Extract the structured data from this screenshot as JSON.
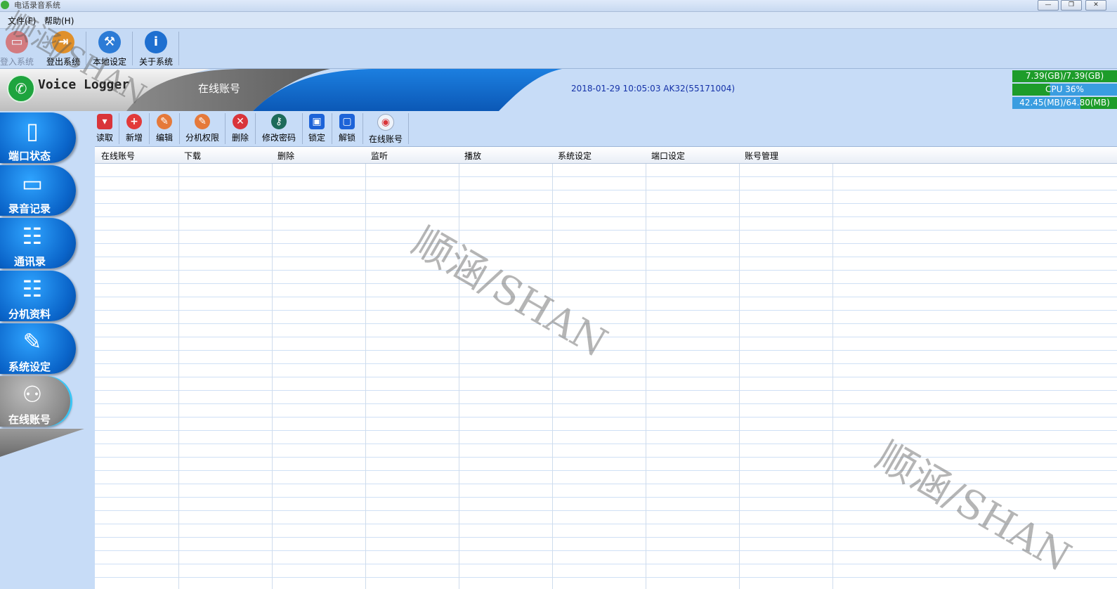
{
  "window": {
    "title": "电话录音系统",
    "controls": {
      "minimize": "—",
      "restore": "❐",
      "close": "✕"
    }
  },
  "menu": [
    {
      "label": "文件(F)"
    },
    {
      "label": "帮助(H)"
    }
  ],
  "toolbar": [
    {
      "label": "登入系统",
      "icon": "monitor-login-icon",
      "color": "#d9534f"
    },
    {
      "label": "登出系统",
      "icon": "logout-icon",
      "color": "#e0902a"
    },
    {
      "label": "本地设定",
      "icon": "tools-icon",
      "color": "#2c7bd6"
    },
    {
      "label": "关于系统",
      "icon": "info-icon",
      "color": "#1e6fd0"
    }
  ],
  "banner": {
    "logo_text": "Voice Logger",
    "section_title": "在线账号",
    "datetime": "2018-01-29 10:05:03",
    "account": "AK32(55171004)"
  },
  "stats": {
    "disk": "7.39(GB)/7.39(GB)",
    "cpu": "CPU 36%",
    "memory": "42.45(MB)/64.80(MB)"
  },
  "sidenav": [
    {
      "label": "端口状态",
      "icon": "port-status-icon",
      "active": false
    },
    {
      "label": "录音记录",
      "icon": "tape-icon",
      "active": false
    },
    {
      "label": "通讯录",
      "icon": "contacts-icon",
      "active": false
    },
    {
      "label": "分机资料",
      "icon": "extension-info-icon",
      "active": false
    },
    {
      "label": "系统设定",
      "icon": "wrench-icon",
      "active": false
    },
    {
      "label": "在线账号",
      "icon": "users-icon",
      "active": true
    }
  ],
  "subtoolbar": [
    {
      "label": "读取",
      "icon": "read-icon",
      "color": "#d9343a",
      "glyph": "▾"
    },
    {
      "label": "新增",
      "icon": "add-icon",
      "color": "#e23a3a",
      "glyph": "+"
    },
    {
      "label": "编辑",
      "icon": "edit-icon",
      "color": "#e5793a",
      "glyph": "✎"
    },
    {
      "label": "分机权限",
      "icon": "extension-permission-icon",
      "color": "#e5793a",
      "glyph": "✎"
    },
    {
      "label": "删除",
      "icon": "delete-icon",
      "color": "#d9343a",
      "glyph": "✕"
    },
    {
      "label": "修改密码",
      "icon": "key-icon",
      "color": "#1d6b5a",
      "glyph": "⚷"
    },
    {
      "label": "锁定",
      "icon": "lock-icon",
      "color": "#1d63d8",
      "glyph": "🔒"
    },
    {
      "label": "解锁",
      "icon": "unlock-icon",
      "color": "#1d63d8",
      "glyph": "🔓"
    },
    {
      "label": "在线账号",
      "icon": "online-account-icon",
      "color": "#d9343a",
      "glyph": "◉"
    }
  ],
  "table": {
    "columns": [
      "在线账号",
      "下载",
      "删除",
      "监听",
      "播放",
      "系统设定",
      "端口设定",
      "账号管理"
    ],
    "rows": []
  },
  "watermark": "顺涵/SHAN"
}
